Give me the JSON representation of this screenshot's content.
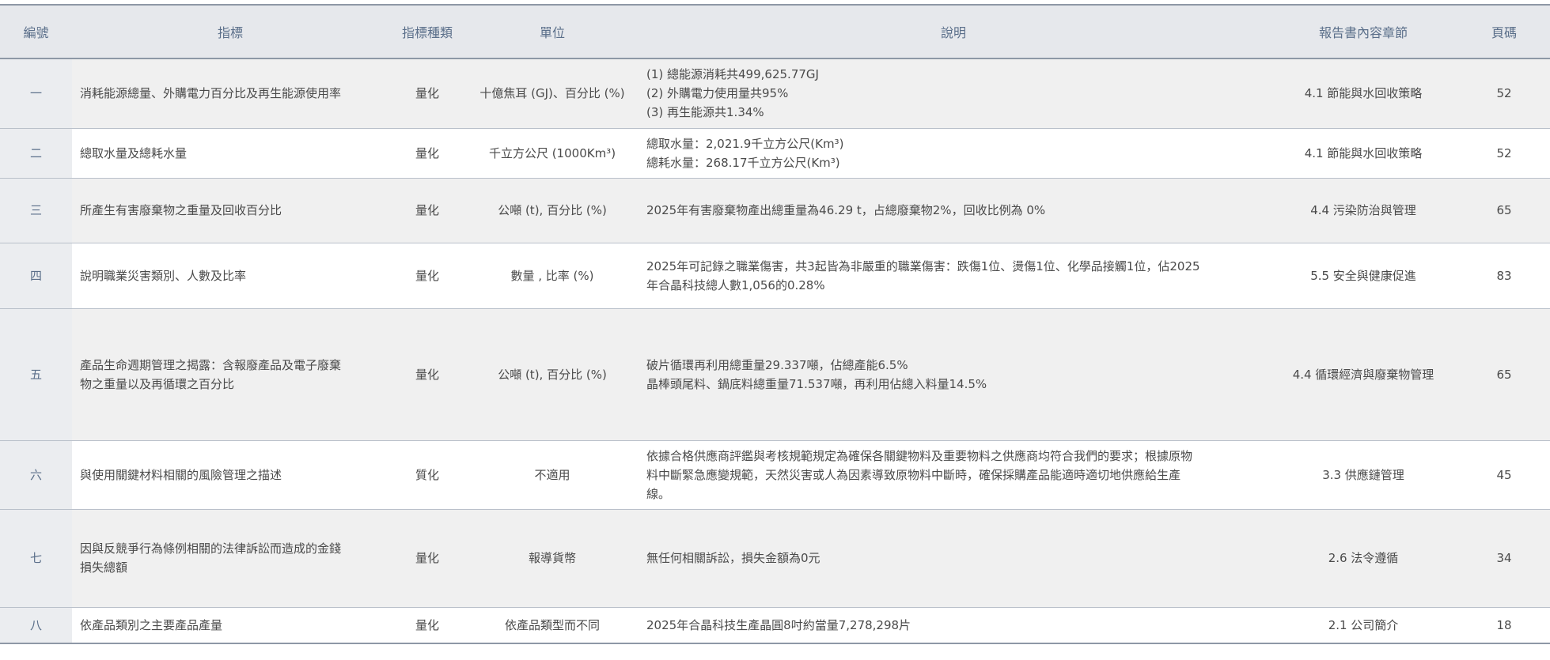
{
  "headers": [
    "編號",
    "指標",
    "指標種類",
    "單位",
    "說明",
    "報告書內容章節",
    "頁碼"
  ],
  "rows": [
    {
      "no": "一",
      "indicator": "消耗能源總量、外購電力百分比及再生能源使用率",
      "type": "量化",
      "unit": "十億焦耳 (GJ)、百分比 (%)",
      "desc": [
        "(1) 總能源消耗共499,625.77GJ",
        "(2) 外購電力使用量共95%",
        "(3) 再生能源共1.34%"
      ],
      "section": "4.1 節能與水回收策略",
      "page": "52"
    },
    {
      "no": "二",
      "indicator": "總取水量及總耗水量",
      "type": "量化",
      "unit": "千立方公尺 (1000Km³)",
      "desc": [
        "總取水量：2,021.9千立方公尺(Km³)",
        "總耗水量：268.17千立方公尺(Km³)"
      ],
      "section": "4.1 節能與水回收策略",
      "page": "52"
    },
    {
      "no": "三",
      "indicator": "所產生有害廢棄物之重量及回收百分比",
      "type": "量化",
      "unit": "公噸 (t), 百分比 (%)",
      "desc": [
        "2025年有害廢棄物產出總重量為46.29 t，占總廢棄物2%，回收比例為 0%"
      ],
      "section": "4.4 污染防治與管理",
      "page": "65"
    },
    {
      "no": "四",
      "indicator": "說明職業災害類別、人數及比率",
      "type": "量化",
      "unit": "數量 , 比率 (%)",
      "desc": [
        "2025年可記錄之職業傷害，共3起皆為非嚴重的職業傷害：跌傷1位、燙傷1位、化學品接觸1位，佔2025",
        "年合晶科技總人數1,056的0.28%"
      ],
      "section": "5.5 安全與健康促進",
      "page": "83"
    },
    {
      "no": "五",
      "indicator": [
        "產品生命週期管理之揭露：含報廢產品及電子廢棄",
        "物之重量以及再循環之百分比"
      ],
      "type": "量化",
      "unit": "公噸 (t), 百分比 (%)",
      "desc": [
        "破片循環再利用總重量29.337噸，佔總產能6.5%",
        "晶棒頭尾料、鍋底料總重量71.537噸，再利用佔總入料量14.5%"
      ],
      "section": "4.4 循環經濟與廢棄物管理",
      "page": "65"
    },
    {
      "no": "六",
      "indicator": "與使用關鍵材料相關的風險管理之描述",
      "type": "質化",
      "unit": "不適用",
      "desc": [
        "依據合格供應商評鑑與考核規範規定為確保各關鍵物料及重要物料之供應商均符合我們的要求；根據原物",
        "料中斷緊急應變規範，天然災害或人為因素導致原物料中斷時，確保採購產品能適時適切地供應給生產",
        "線。"
      ],
      "section": "3.3 供應鏈管理",
      "page": "45"
    },
    {
      "no": "七",
      "indicator": [
        "因與反競爭行為條例相關的法律訴訟而造成的金錢",
        "損失總額"
      ],
      "type": "量化",
      "unit": "報導貨幣",
      "desc": [
        "無任何相關訴訟，損失金額為0元"
      ],
      "section": "2.6 法令遵循",
      "page": "34"
    },
    {
      "no": "八",
      "indicator": "依產品類別之主要產品產量",
      "type": "量化",
      "unit": "依產品類型而不同",
      "desc": [
        "2025年合晶科技生產晶圓8吋約當量7,278,298片"
      ],
      "section": "2.1 公司簡介",
      "page": "18"
    }
  ]
}
